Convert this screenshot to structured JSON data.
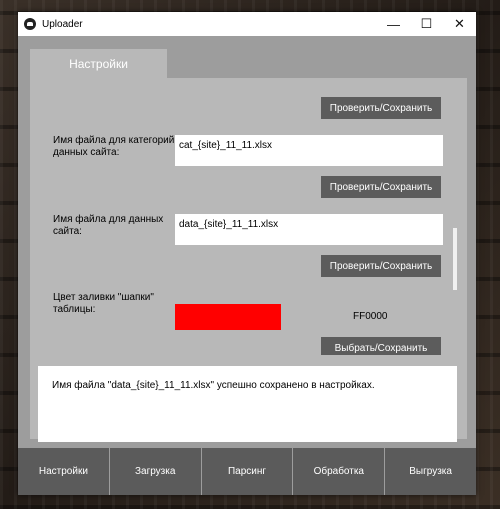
{
  "window": {
    "title": "Uploader",
    "controls": {
      "minimize": "—",
      "maximize": "☐",
      "close": "✕"
    }
  },
  "tab": {
    "label": "Настройки"
  },
  "settings": {
    "top_button": "Проверить/Сохранить",
    "category_file": {
      "label": "Имя файла для категорий данных сайта:",
      "value": "cat_{site}_11_11.xlsx",
      "button": "Проверить/Сохранить"
    },
    "data_file": {
      "label": "Имя файла для данных сайта:",
      "value": "data_{site}_11_11.xlsx",
      "button": "Проверить/Сохранить"
    },
    "header_color": {
      "label": "Цвет заливки \"шапки\" таблицы:",
      "color": "#FF0000",
      "hex_text": "FF0000",
      "button": "Выбрать/Сохранить"
    }
  },
  "log": {
    "message": "Имя файла \"data_{site}_11_11.xlsx\" успешно сохранено в настройках."
  },
  "bottom_nav": [
    {
      "label": "Настройки"
    },
    {
      "label": "Загрузка"
    },
    {
      "label": "Парсинг"
    },
    {
      "label": "Обработка"
    },
    {
      "label": "Выгрузка"
    }
  ]
}
